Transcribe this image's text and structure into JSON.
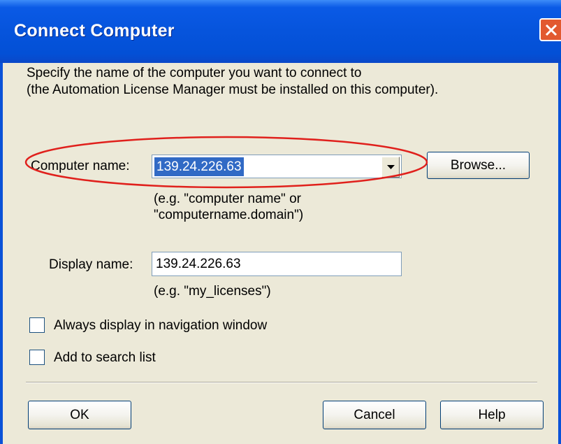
{
  "dialog": {
    "title": "Connect Computer",
    "description_line1": "Specify the name of the computer you want to connect to",
    "description_line2": "(the Automation License Manager must be installed on this computer)."
  },
  "computer_name": {
    "label": "Computer name:",
    "value": "139.24.226.63",
    "hint_line1": "(e.g. \"computer name\" or",
    "hint_line2": "\"computername.domain\")"
  },
  "browse_button": {
    "label": "Browse..."
  },
  "display_name": {
    "label": "Display name:",
    "value": "139.24.226.63",
    "hint": "(e.g. \"my_licenses\")"
  },
  "checkboxes": [
    {
      "label": "Always display in navigation window",
      "checked": false
    },
    {
      "label": "Add to search list",
      "checked": false
    }
  ],
  "buttons": {
    "ok": "OK",
    "cancel": "Cancel",
    "help": "Help"
  },
  "colors": {
    "titlebar": "#0654dc",
    "selection": "#316ac5",
    "annotation": "#e0201c"
  },
  "icons": [
    "close-icon",
    "dropdown-arrow-icon"
  ]
}
